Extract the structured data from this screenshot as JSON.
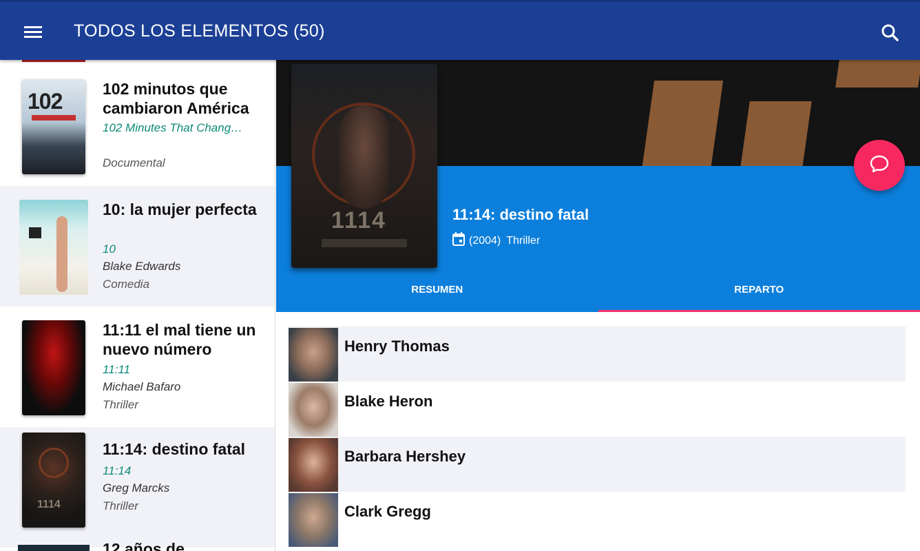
{
  "appbar": {
    "title": "TODOS LOS ELEMENTOS (50)",
    "menu_icon": "menu-icon",
    "search_icon": "search-icon",
    "color": "#1c3f96"
  },
  "list": {
    "items": [
      {
        "title": "102 minutos que cambiaron América",
        "original_title": "102 Minutes That Chang…",
        "director": "",
        "genre": "Documental"
      },
      {
        "title": "10: la mujer perfecta",
        "original_title": "10",
        "director": "Blake Edwards",
        "genre": "Comedia"
      },
      {
        "title": "11:11 el mal tiene un nuevo número",
        "original_title": "11:11",
        "director": "Michael Bafaro",
        "genre": "Thriller"
      },
      {
        "title": "11:14: destino fatal",
        "original_title": "11:14",
        "director": "Greg Marcks",
        "genre": "Thriller"
      },
      {
        "title": "12 años de",
        "original_title": "",
        "director": "",
        "genre": ""
      }
    ]
  },
  "detail": {
    "title": "11:14: destino fatal",
    "year": "(2004)",
    "genre": "Thriller",
    "calendar_icon": "calendar-icon",
    "header_color": "#0c7fdc",
    "accent_color": "#f72860",
    "tabs": [
      {
        "label": "RESUMEN",
        "active": false
      },
      {
        "label": "REPARTO",
        "active": true
      }
    ],
    "fab_icon": "chat-bubble-icon",
    "cast": [
      {
        "name": "Henry Thomas"
      },
      {
        "name": "Blake Heron"
      },
      {
        "name": "Barbara Hershey"
      },
      {
        "name": "Clark Gregg"
      }
    ]
  }
}
